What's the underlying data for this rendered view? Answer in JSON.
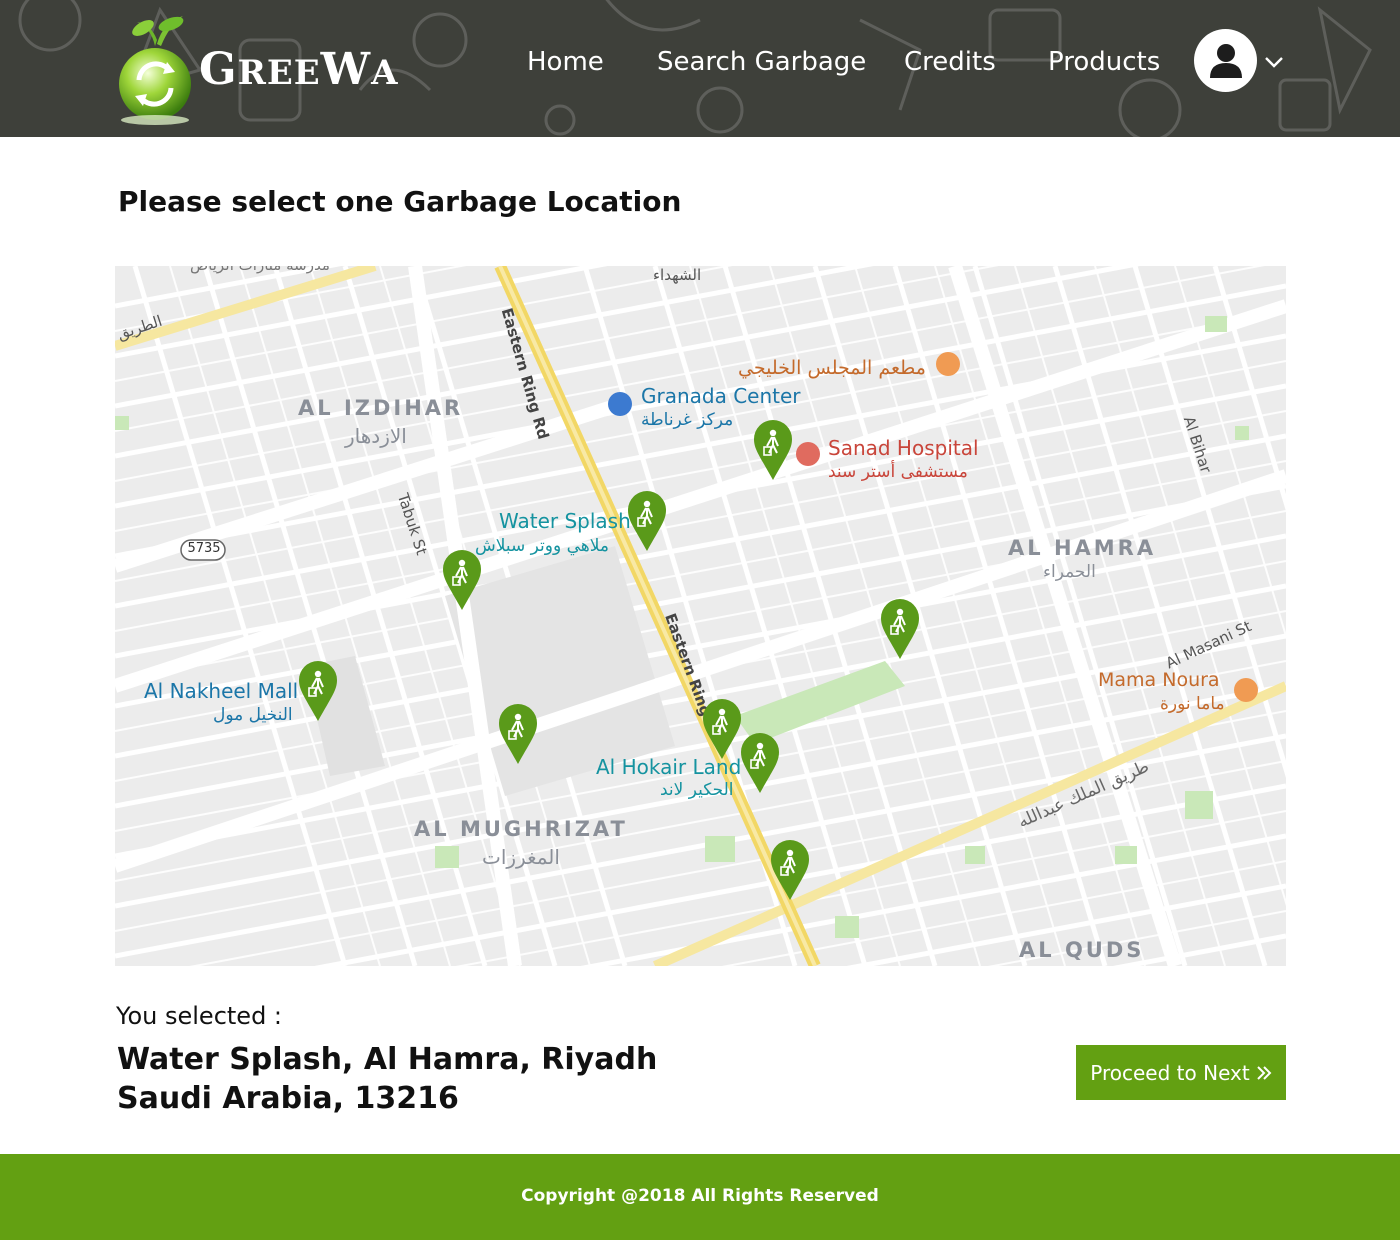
{
  "brand": {
    "name_first": "G",
    "name_mid": "REE",
    "name_w": "W",
    "name_end": "A"
  },
  "nav": {
    "items": [
      "Home",
      "Search Garbage",
      "Credits",
      "Products"
    ]
  },
  "page": {
    "title": "Please select one Garbage Location",
    "selected_label": "You selected :",
    "address_line1": "Water Splash, Al Hamra, Riyadh",
    "address_line2": "Saudi Arabia, 13216",
    "proceed_label": "Proceed to Next"
  },
  "map": {
    "districts": {
      "izdihar": "AL IZDIHAR",
      "izdihar_ar": "الازدهار",
      "hamra": "AL HAMRA",
      "hamra_ar": "الحمراء",
      "mughrizat": "AL MUGHRIZAT",
      "mughrizat_ar": "المغرزات",
      "quds": "AL QUDS"
    },
    "pois": {
      "granada": "Granada Center",
      "granada_ar": "مركز غرناطة",
      "sanad": "Sanad Hospital",
      "sanad_ar": "مستشفى أستر سند",
      "majlis_ar": "مطعم المجلس الخليجي",
      "water_splash": "Water Splash",
      "water_splash_ar": "ملاهي ووتر سبلاش",
      "nakheel": "Al Nakheel Mall",
      "nakheel_ar": "النخيل مول",
      "hokair": "Al Hokair Land",
      "hokair_ar": "الحكير لاند",
      "mama": "Mama Noura",
      "mama_ar": "ماما نورة",
      "school_ar": "مدرسة منارات الرياض",
      "shuhada_ar": "الشهداء"
    },
    "streets": {
      "eastern_ring": "Eastern Ring Rd",
      "eastern_ring_short": "Eastern Ring",
      "tabuk": "Tabuk St",
      "bihar": "Al Bihar",
      "masani": "Al Masani St",
      "king_abdullah_ar": "طريق الملك عبدالله",
      "tariq_ar": "الطريق",
      "route": "5735"
    }
  },
  "footer": {
    "copyright": "Copyright @2018 All Rights Reserved"
  },
  "colors": {
    "header_bg": "#3e403a",
    "accent_green": "#63a012",
    "pin_green": "#5a9a1a",
    "ring_road": "#f4e38a"
  },
  "icons": [
    "recycle-globe-icon",
    "user-icon",
    "chevron-down-icon",
    "garbage-pin-icon",
    "double-chevron-right-icon"
  ]
}
